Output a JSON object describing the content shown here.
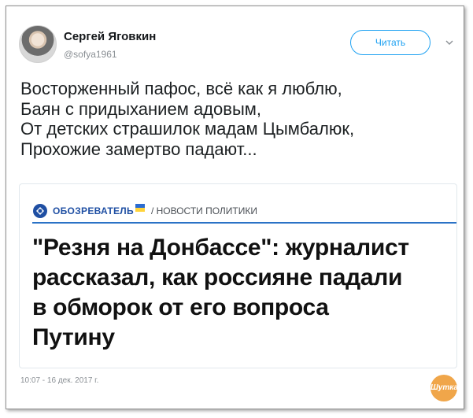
{
  "tweet": {
    "author_name": "Сергей Яговкин",
    "author_handle": "@sofya1961",
    "follow_label": "Читать",
    "text_lines": [
      "Восторженный пафос, всё как я люблю,",
      "Баян с придыханием адовым,",
      "От детских страшилок мадам Цымбалюк,",
      "Прохожие замертво падают..."
    ],
    "timestamp": "10:07 - 16 дек. 2017 г."
  },
  "embed": {
    "source_name": "ОБОЗРЕВАТЕЛЬ",
    "section": "/ НОВОСТИ ПОЛИТИКИ",
    "headline_lines": [
      "\"Резня на Донбассе\": журналист",
      "рассказал, как россияне падали",
      "в обморок от его вопроса",
      "Путину"
    ]
  },
  "watermark": {
    "text": "Шутка"
  },
  "colors": {
    "accent": "#1da1f2",
    "source_blue": "#1f4fa3",
    "rule_blue": "#2a72c6",
    "watermark": "#f0a64a"
  },
  "icons": [
    "avatar",
    "chevron-down-icon",
    "source-logo-icon"
  ]
}
